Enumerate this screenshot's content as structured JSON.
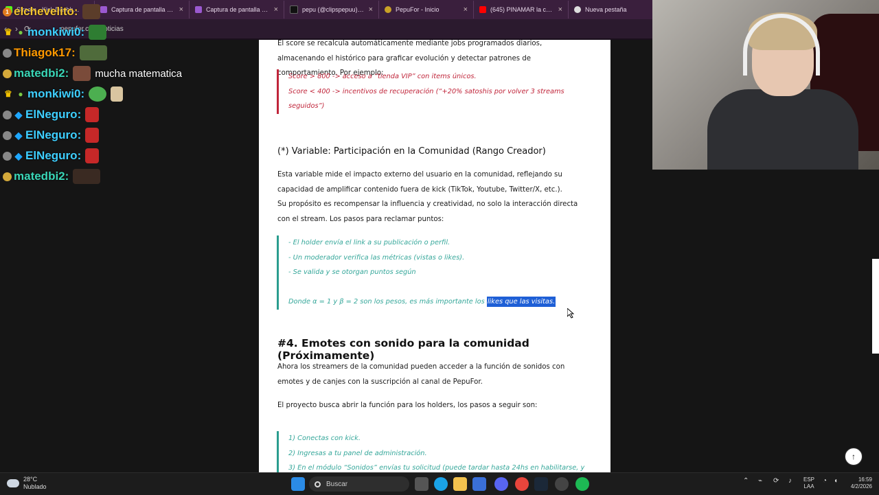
{
  "browser": {
    "tabs": [
      {
        "label": "Stream - Kick Dashboard",
        "color": "#53fc18"
      },
      {
        "label": "Captura de pantalla por L",
        "color": "#9b59d0"
      },
      {
        "label": "Captura de pantalla por L",
        "color": "#9b59d0"
      },
      {
        "label": "pepu (@clipspepuu) | TikT",
        "color": "#111111"
      },
      {
        "label": "PepuFor - Inicio",
        "color": "#c9a227"
      },
      {
        "label": "(645) PINAMAR la canción",
        "color": "#ff0000"
      }
    ],
    "new_tab_label": "Nueva pestaña",
    "url": "pepufor.com/noticias"
  },
  "chat": [
    {
      "user": "elchevelito",
      "color": "#f4c430",
      "badge": "1",
      "badge_type": "orange",
      "text": ""
    },
    {
      "user": "monkiwi0",
      "color": "#3ecfff",
      "badge": "♛",
      "badge_type": "crown",
      "text": ""
    },
    {
      "user": "Thiagok17",
      "color": "#ff9900",
      "badge": "",
      "badge_type": "grey",
      "text": ""
    },
    {
      "user": "matedbi2",
      "color": "#3ad6b7",
      "badge": "",
      "badge_type": "gold",
      "text": "mucha matematica"
    },
    {
      "user": "monkiwi0",
      "color": "#3ecfff",
      "badge": "♛",
      "badge_type": "crown",
      "text": ""
    },
    {
      "user": "ElNeguro",
      "color": "#3ecfff",
      "badge": "◆",
      "badge_type": "blue",
      "text": ""
    },
    {
      "user": "ElNeguro",
      "color": "#3ecfff",
      "badge": "◆",
      "badge_type": "blue",
      "text": ""
    },
    {
      "user": "ElNeguro",
      "color": "#3ecfff",
      "badge": "◆",
      "badge_type": "blue",
      "text": ""
    },
    {
      "user": "matedbi2",
      "color": "#3ad6b7",
      "badge": "",
      "badge_type": "gold",
      "text": ""
    }
  ],
  "article": {
    "p1": "El score se recalcula automáticamente mediante jobs programados diarios, almacenando el histórico para graficar evolución y detectar patrones de comportamiento. Por ejemplo:",
    "red_callout": [
      "Score > 800 -> acceso a “tienda VIP” con items únicos.",
      "Score < 400 -> incentivos de recuperación (“+20% satoshis por volver 3 streams seguidos”)"
    ],
    "h3": "(*) Variable: Participación en la Comunidad (Rango Creador)",
    "p2": "Esta variable mide el impacto externo del usuario en la comunidad, reflejando su capacidad de amplificar contenido fuera de kick (TikTok, Youtube, Twitter/X, etc.).",
    "p3": "Su propósito es recompensar la influencia y creatividad, no solo la interacción directa con el stream. Los pasos para reclamar puntos:",
    "teal_callout": [
      "- El holder envía el link a su publicación o perfil.",
      "- Un moderador verifica las métricas (vistas o likes).",
      "- Se valida y se otorgan puntos según"
    ],
    "formula_text": "Donde α = 1 y β = 2 son los pesos, es más importante los ",
    "formula_highlight": "likes que las visitas.",
    "h2": "#4. Emotes con sonido para la comunidad (Próximamente)",
    "p4": "Ahora los streamers de la comunidad pueden acceder a la función de sonidos con emotes y de canjes con la suscripción al canal de PepuFor.",
    "p5": "El proyecto busca abrir la función para los holders, los pasos a seguir son:",
    "steps": [
      "1) Conectas con kick.",
      "2) Ingresas a tu panel de administración.",
      "3) En el módulo “Sonidos” envías tu solicitud (puede tardar hasta 24hs en habilitarse, y"
    ]
  },
  "taskbar": {
    "temp": "28°C",
    "weather": "Nublado",
    "search_placeholder": "Buscar",
    "lang1": "ESP",
    "lang2": "LAA",
    "time": "16:59",
    "date": "4/2/2026"
  }
}
